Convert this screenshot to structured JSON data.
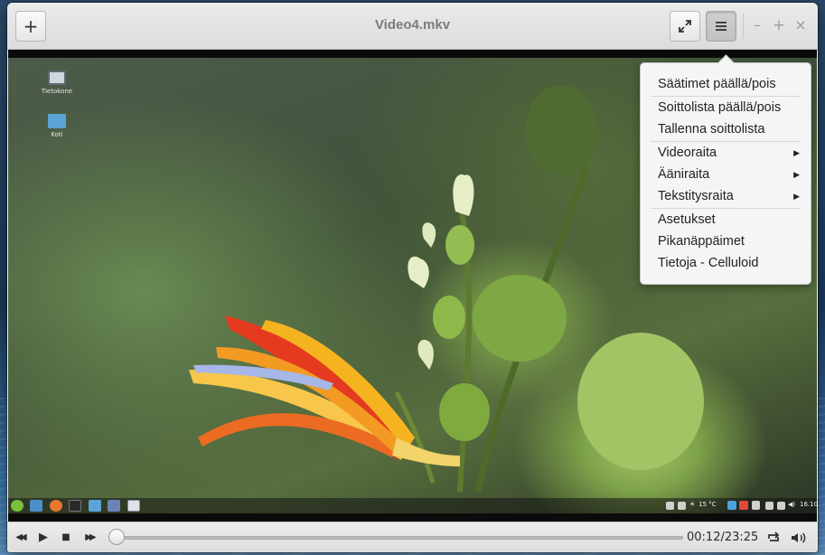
{
  "window": {
    "title": "Video4.mkv",
    "add_label": "+",
    "fullscreen_icon": "expand-icon",
    "menu_icon": "hamburger-icon",
    "minimize_label": "–",
    "maximize_label": "+",
    "close_label": "×"
  },
  "desktop": {
    "icons": [
      {
        "label": "Tietokone",
        "icon": "computer-icon"
      },
      {
        "label": "Koti",
        "icon": "home-folder-icon"
      }
    ],
    "panel": {
      "temperature": "15 °C",
      "clock": "16.10"
    }
  },
  "menu": {
    "items": [
      {
        "label": "Säätimet päällä/pois",
        "submenu": false
      },
      {
        "label": "Soittolista päällä/pois",
        "submenu": false
      },
      {
        "label": "Tallenna soittolista",
        "submenu": false
      },
      {
        "label": "Videoraita",
        "submenu": true
      },
      {
        "label": "Ääniraita",
        "submenu": true
      },
      {
        "label": "Tekstitysraita",
        "submenu": true
      },
      {
        "label": "Asetukset",
        "submenu": false
      },
      {
        "label": "Pikanäppäimet",
        "submenu": false
      },
      {
        "label": "Tietoja - Celluloid",
        "submenu": false
      }
    ],
    "arrow": "▶"
  },
  "controls": {
    "rewind": "◀◀",
    "play": "▶",
    "stop": "■",
    "forward": "▶▶",
    "time": "00:12/23:25",
    "progress_fraction": 0.0085,
    "loop_icon": "repeat-icon",
    "volume_icon": "volume-icon"
  },
  "colors": {
    "accent": "#4a90d9"
  }
}
